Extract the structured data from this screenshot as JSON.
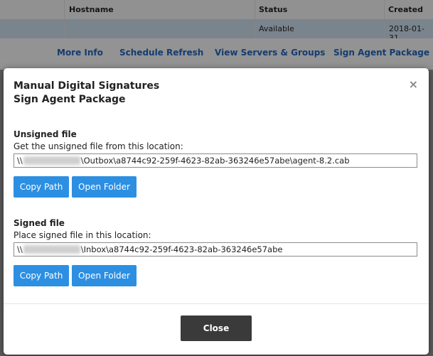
{
  "table": {
    "headers": [
      "Hostname",
      "Status",
      "Created"
    ],
    "row": {
      "status": "Available",
      "created": "2018-01-31"
    }
  },
  "actions": [
    "More Info",
    "Schedule Refresh",
    "View Servers & Groups",
    "Sign Agent Package"
  ],
  "modal": {
    "title_line1": "Manual Digital Signatures",
    "title_line2": "Sign Agent Package",
    "close_icon": "×",
    "unsigned": {
      "label": "Unsigned file",
      "description": "Get the unsigned file from this location:",
      "path_prefix": "\\\\",
      "path_suffix": "\\Outbox\\a8744c92-259f-4623-82ab-363246e57abe\\agent-8.2.cab",
      "copy_label": "Copy Path",
      "open_label": "Open Folder"
    },
    "signed": {
      "label": "Signed file",
      "description": "Place signed file in this location:",
      "path_prefix": "\\\\",
      "path_suffix": "\\Inbox\\a8744c92-259f-4623-82ab-363246e57abe",
      "copy_label": "Copy Path",
      "open_label": "Open Folder"
    },
    "close_label": "Close"
  },
  "colors": {
    "primary": "#2c8fe2",
    "dark": "#3a3a3a",
    "link": "#1e5aa8"
  }
}
